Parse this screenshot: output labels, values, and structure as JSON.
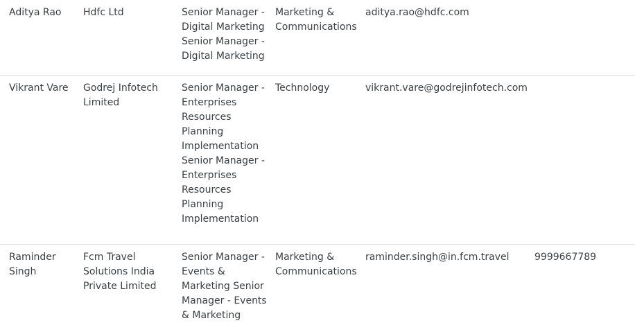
{
  "contacts": [
    {
      "name": "Aditya Rao",
      "company": "Hdfc Ltd",
      "designation": "Senior Manager - Digital Marketing Senior Manager - Digital Marketing",
      "department": "Marketing & Communications",
      "email": "aditya.rao@hdfc.com",
      "phone": ""
    },
    {
      "name": "Vikrant Vare",
      "company": "Godrej Infotech Limited",
      "designation": "Senior Manager - Enterprises Resources Planning Implementation Senior Manager - Enterprises Resources Planning Implementation",
      "department": "Technology",
      "email": "vikrant.vare@godrejinfotech.com",
      "phone": ""
    },
    {
      "name": "Raminder Singh",
      "company": "Fcm Travel Solutions India Private Limited",
      "designation": "Senior Manager - Events & Marketing Senior Manager - Events & Marketing",
      "department": "Marketing & Communications",
      "email": "raminder.singh@in.fcm.travel",
      "phone": "9999667789"
    }
  ]
}
